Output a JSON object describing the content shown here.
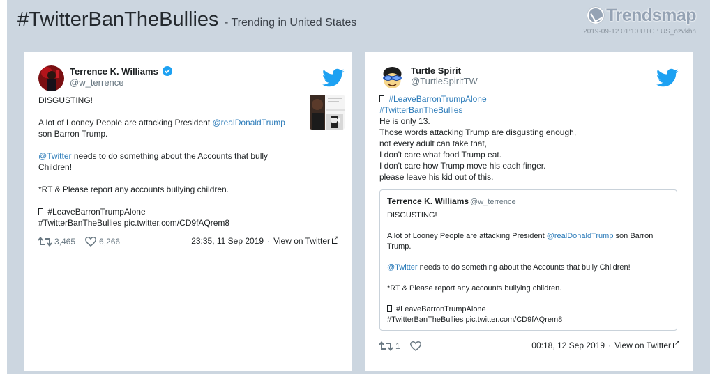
{
  "header": {
    "hashtag": "#TwitterBanTheBullies",
    "subtitle": "- Trending in United States",
    "logo": "Trendsmap",
    "meta": "2019-09-12 01:10 UTC : US_ozvkhn"
  },
  "colors": {
    "frame": "#ccd6e0",
    "link": "#2b7bb9",
    "twitter_blue": "#1da1f2",
    "verified": "#1da1f2"
  },
  "tweets": [
    {
      "name": "Terrence K. Williams",
      "verified": true,
      "handle": "@w_terrence",
      "lines": {
        "l1": "DISGUSTING!",
        "l2a": "A lot of Looney People are attacking President ",
        "l2b": "@realDonaldTrump",
        "l2c": "son Barron Trump.",
        "l3a": "@Twitter",
        "l3b": " needs to do something about the Accounts that bully",
        "l3c": "Children!",
        "l4": "*RT & Please report any accounts bullying children.",
        "l5": " #LeaveBarronTrumpAlone",
        "l6": "#TwitterBanTheBullies pic.twitter.com/CD9fAQrem8"
      },
      "retweets": "3,465",
      "likes": "6,266",
      "timestamp": "23:35, 11 Sep 2019",
      "view_on": "View on Twitter",
      "retweet_icon": "retweet-icon",
      "like_icon": "heart-icon"
    },
    {
      "name": "Turtle Spirit",
      "handle": "@TurtleSpiritTW",
      "lines": {
        "l1": " #LeaveBarronTrumpAlone",
        "l2": "#TwitterBanTheBullies",
        "l3": "He is only 13.",
        "l4": "Those words attacking Trump are disgusting enough,",
        "l5": "not every adult can take that,",
        "l6": "I don't care what food Trump eat.",
        "l7": "I don't care how Trump move his each finger.",
        "l8": "please leave his kid out of this."
      },
      "quote": {
        "name": "Terrence K. Williams",
        "handle": "@w_terrence",
        "q1": "DISGUSTING!",
        "q2a": "A lot of Looney People are attacking President ",
        "q2b": "@realDonaldTrump",
        "q2c": " son Barron",
        "q2d": "Trump.",
        "q3a": "@Twitter",
        "q3b": " needs to do something about the Accounts that bully Children!",
        "q4": "*RT & Please report any accounts bullying children.",
        "q5": " #LeaveBarronTrumpAlone",
        "q6": "#TwitterBanTheBullies pic.twitter.com/CD9fAQrem8"
      },
      "retweets": "1",
      "timestamp": "00:18, 12 Sep 2019",
      "view_on": "View on Twitter"
    }
  ]
}
